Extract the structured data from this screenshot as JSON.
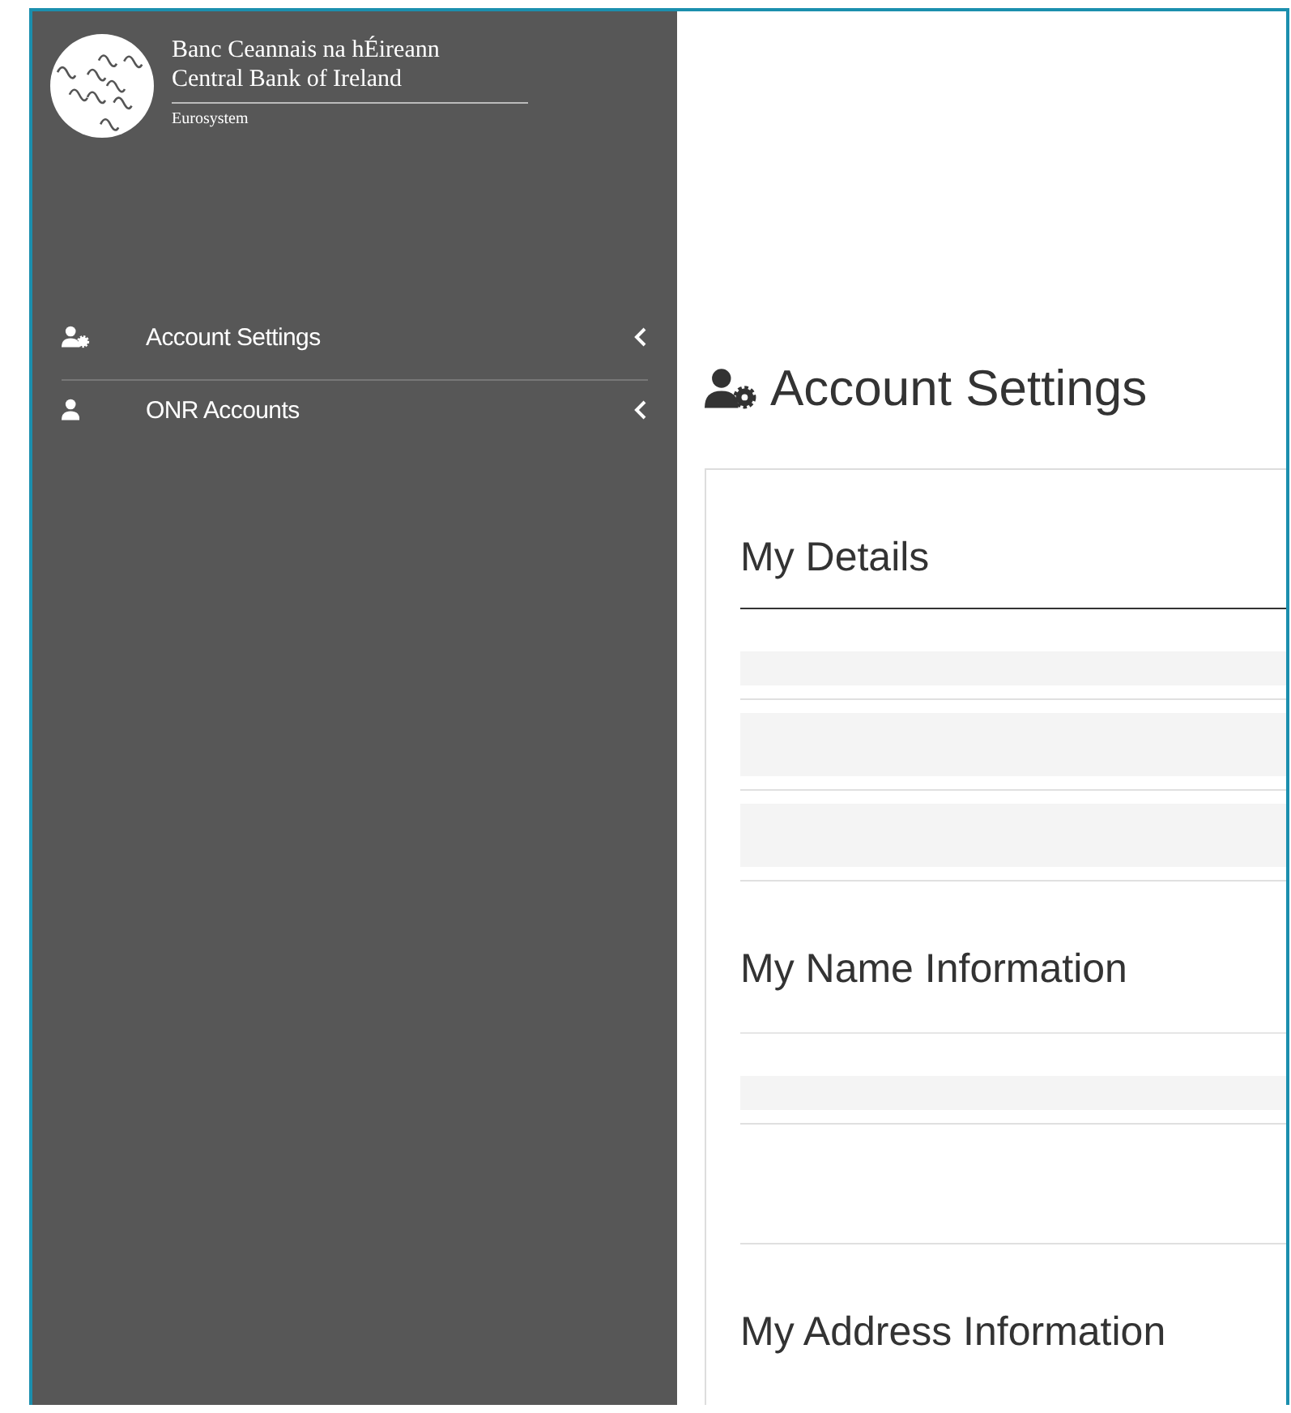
{
  "brand": {
    "line_1": "Banc Ceannais na hÉireann",
    "line_2": "Central Bank of Ireland",
    "tagline": "Eurosystem"
  },
  "sidebar": {
    "items": [
      {
        "label": "Account Settings",
        "kind": "settings",
        "expanded": false
      },
      {
        "label": "ONR Accounts",
        "kind": "accounts",
        "expanded": false
      }
    ]
  },
  "page": {
    "title": "Account Settings"
  },
  "sections": [
    {
      "title": "My Details",
      "rows": [
        {
          "kind": "filled"
        },
        {
          "kind": "filled"
        },
        {
          "kind": "filled"
        }
      ]
    },
    {
      "title": "My Name Information",
      "rows": [
        {
          "kind": "filled"
        },
        {
          "kind": "blank"
        }
      ]
    },
    {
      "title": "My Address Information"
    }
  ]
}
